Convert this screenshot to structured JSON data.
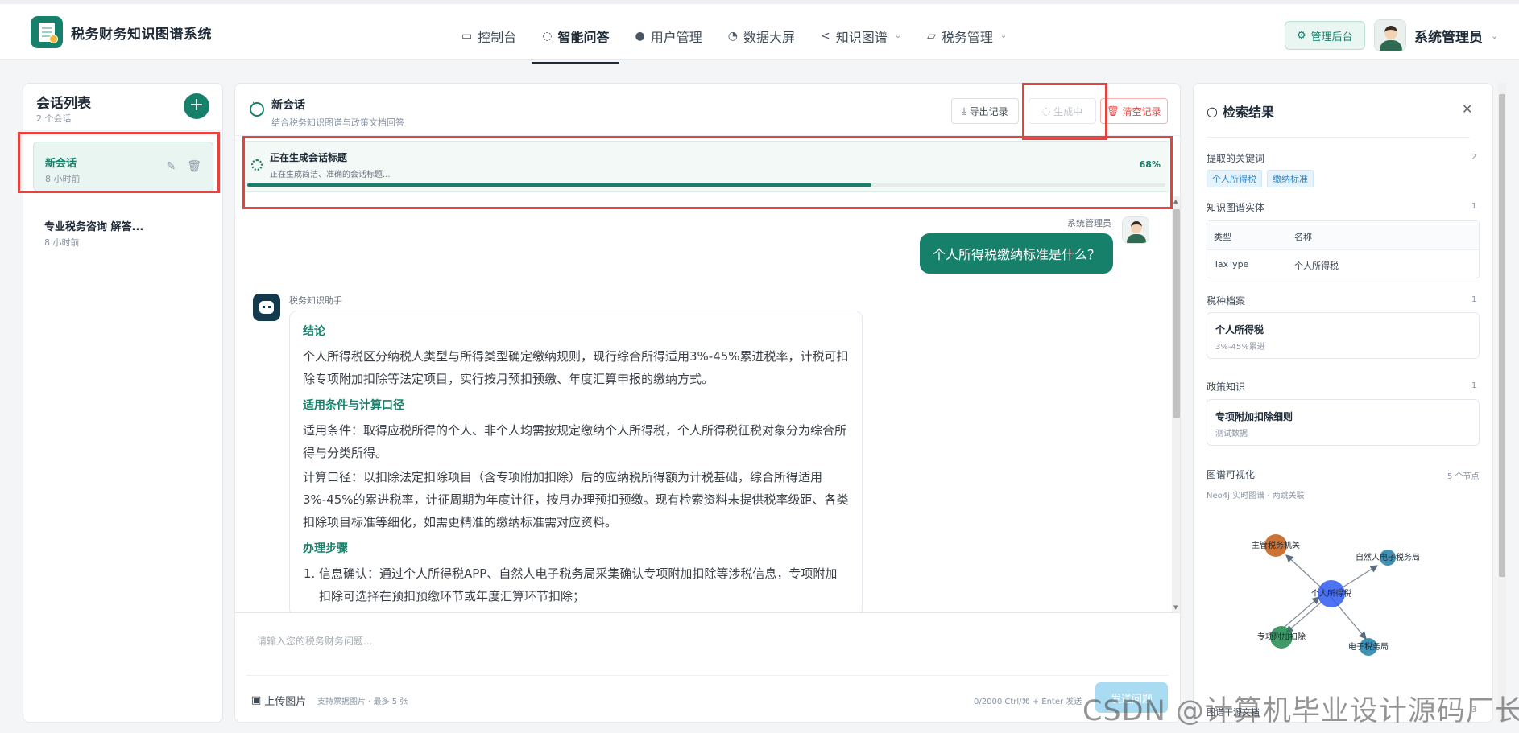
{
  "app": {
    "title": "税务财务知识图谱系统"
  },
  "nav": [
    {
      "label": "控制台",
      "icon": "monitor-icon",
      "active": false
    },
    {
      "label": "智能问答",
      "icon": "chat-icon",
      "active": true
    },
    {
      "label": "用户管理",
      "icon": "user-icon",
      "active": false
    },
    {
      "label": "数据大屏",
      "icon": "pie-chart-icon",
      "active": false
    },
    {
      "label": "知识图谱",
      "icon": "share-icon",
      "active": false
    },
    {
      "label": "税务管理",
      "icon": "folder-icon",
      "active": false
    }
  ],
  "header": {
    "admin_label": "管理后台",
    "user_name": "系统管理员"
  },
  "conversations": {
    "title": "会话列表",
    "count": "2 个会话",
    "items": [
      {
        "title": "新会话",
        "time": "8 小时前"
      },
      {
        "title": "专业税务咨询 解答...",
        "time": "8 小时前"
      }
    ]
  },
  "chat": {
    "title": "新会话",
    "subtitle": "结合税务知识图谱与政策文档回答",
    "export_label": "导出记录",
    "generating_label": "生成中",
    "clear_label": "清空记录",
    "progress": {
      "title": "正在生成会话标题",
      "subtitle": "正在生成简洁、准确的会话标题...",
      "percent_label": "68%",
      "value": 0.68
    },
    "user": {
      "name": "系统管理员",
      "message": "个人所得税缴纳标准是什么？"
    },
    "bot": {
      "name": "税务知识助手",
      "sections": {
        "conclusion_heading": "结论",
        "conclusion_text": "个人所得税区分纳税人类型与所得类型确定缴纳规则，现行综合所得适用3%-45%累进税率，计税可扣除专项附加扣除等法定项目，实行按月预扣预缴、年度汇算申报的缴纳方式。",
        "conditions_heading": "适用条件与计算口径",
        "conditions_text": "适用条件：取得应税所得的个人、非个人均需按规定缴纳个人所得税，个人所得税征税对象分为综合所得与分类所得。",
        "calc_text": "计算口径：以扣除法定扣除项目（含专项附加扣除）后的应纳税所得额为计税基础，综合所得适用3%-45%的累进税率，计征周期为年度计征，按月办理预扣预缴。现有检索资料未提供税率级距、各类扣除项目标准等细化，如需更精准的缴纳标准需对应资料。",
        "steps_heading": "办理步骤",
        "step1": "信息确认：通过个人所得税APP、自然人电子税务局采集确认专项附加扣除等涉税信息，专项附加扣除可选择在预扣预缴环节或年度汇算环节扣除；"
      }
    },
    "input": {
      "placeholder": "请输入您的税务财务问题...",
      "upload_label": "上传图片",
      "upload_hint": "支持票据图片 · 最多 5 张",
      "counter": "0/2000   Ctrl/⌘ + Enter 发送",
      "send_label": "发送问题"
    }
  },
  "search": {
    "title": "检索结果",
    "keywords": {
      "label": "提取的关键词",
      "count": "2",
      "tags": [
        "个人所得税",
        "缴纳标准"
      ]
    },
    "entities": {
      "label": "知识图谱实体",
      "count": "1",
      "columns": [
        "类型",
        "名称"
      ],
      "rows": [
        [
          "TaxType",
          "个人所得税"
        ]
      ]
    },
    "tax_files": {
      "label": "税种档案",
      "count": "1",
      "card_title": "个人所得税",
      "card_sub": "3%-45%累进"
    },
    "policy": {
      "label": "政策知识",
      "count": "1",
      "card_title": "专项附加扣除细则",
      "card_sub": "测试数据"
    },
    "graph": {
      "label": "图谱可视化",
      "count": "5 个节点",
      "subtitle": "Neo4j 实时图谱 · 两跳关联",
      "nodes": [
        {
          "name": "个人所得税",
          "color": "#2f5bf0"
        },
        {
          "name": "主管税务机关",
          "color": "#c45a12"
        },
        {
          "name": "自然人电子税务局",
          "color": "#1f7fa8"
        },
        {
          "name": "专项附加扣除",
          "color": "#1f8a4c"
        },
        {
          "name": "电子税务局",
          "color": "#1f7fa8"
        }
      ]
    },
    "footer": {
      "label": "图谱干源文档",
      "count": "3"
    }
  },
  "watermark": "CSDN @计算机毕业设计源码厂长",
  "colors": {
    "brand": "#16806a",
    "danger": "#e8423f",
    "highlight_box": "#e8423f"
  }
}
